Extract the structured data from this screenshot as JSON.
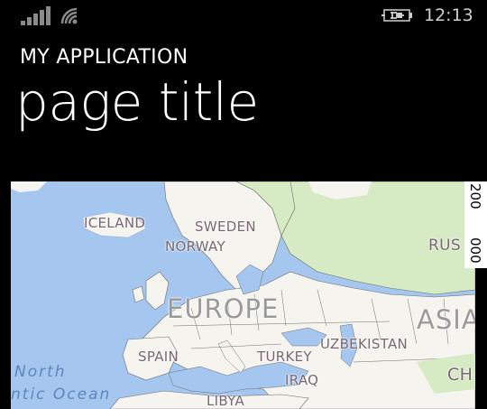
{
  "status": {
    "time": "12:13",
    "signal_icon": "signal-strength-icon",
    "wifi_icon": "wifi-icon",
    "battery_icon": "battery-charging-icon"
  },
  "header": {
    "app_name": "MY APPLICATION",
    "page_title": "page title"
  },
  "map": {
    "scale_labels": [
      "200",
      "000"
    ],
    "labels": {
      "iceland": "ICELAND",
      "sweden": "SWEDEN",
      "norway": "NORWAY",
      "russia": "RUS",
      "europe": "EUROPE",
      "asia": "ASIA",
      "spain": "SPAIN",
      "turkey": "TURKEY",
      "uzbekistan": "UZBEKISTAN",
      "iraq": "IRAQ",
      "china": "CH",
      "libya": "LIBYA",
      "ocean_line1": "North",
      "ocean_line2": "ntic Ocean"
    },
    "colors": {
      "water": "#a4c6ef",
      "land": "#f5f4ef",
      "forest": "#d6eac4",
      "border": "#6e6e6e"
    }
  }
}
